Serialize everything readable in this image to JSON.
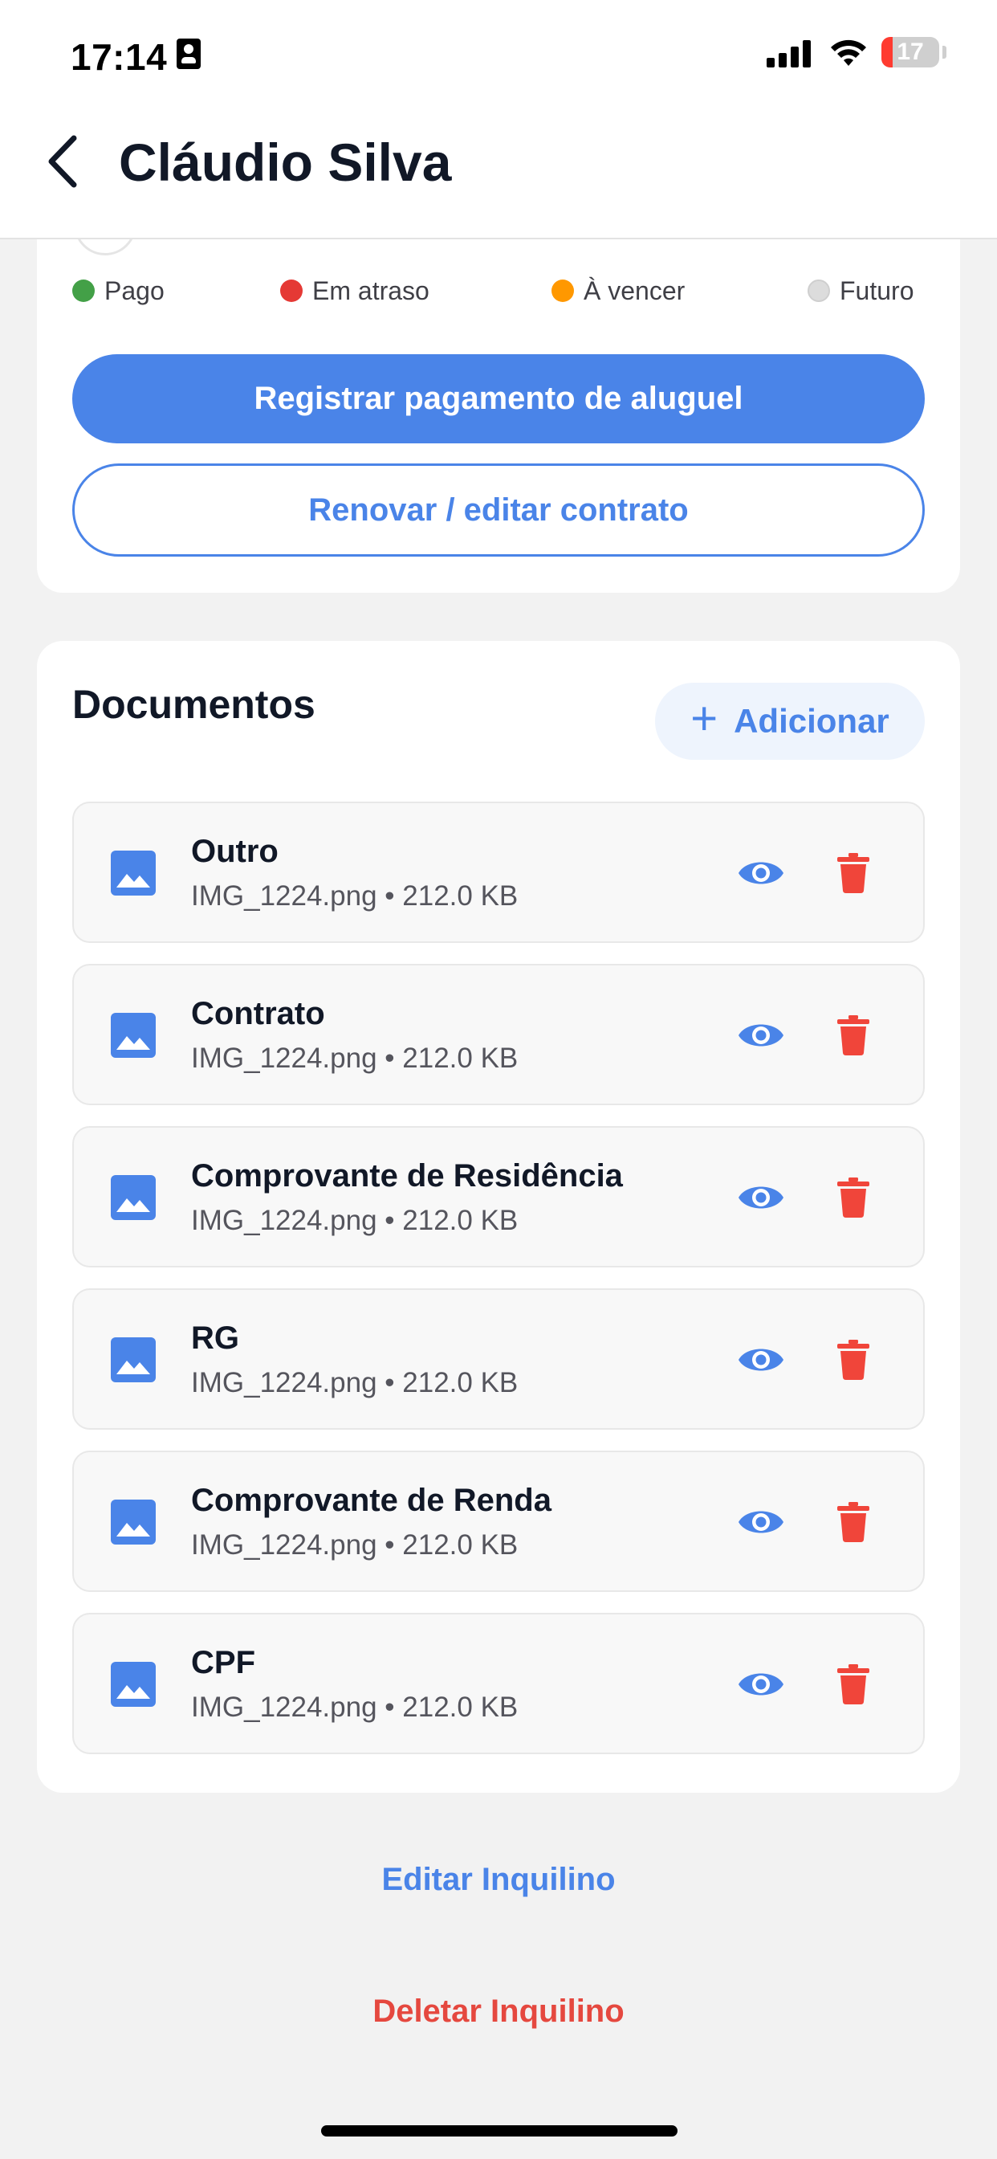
{
  "status_bar": {
    "time": "17:14",
    "battery": "17"
  },
  "header": {
    "title": "Cláudio Silva"
  },
  "legend": [
    {
      "label": "Pago",
      "color": "#43a047"
    },
    {
      "label": "Em atraso",
      "color": "#e53935"
    },
    {
      "label": "À vencer",
      "color": "#ff9800"
    },
    {
      "label": "Futuro",
      "color": "#dcdcdc"
    }
  ],
  "actions": {
    "register_payment": "Registrar pagamento de aluguel",
    "renew_contract": "Renovar / editar contrato"
  },
  "documents": {
    "title": "Documentos",
    "add_label": "Adicionar",
    "items": [
      {
        "name": "Outro",
        "file": "IMG_1224.png",
        "size": "212.0 KB"
      },
      {
        "name": "Contrato",
        "file": "IMG_1224.png",
        "size": "212.0 KB"
      },
      {
        "name": "Comprovante de Residência",
        "file": "IMG_1224.png",
        "size": "212.0 KB"
      },
      {
        "name": "RG",
        "file": "IMG_1224.png",
        "size": "212.0 KB"
      },
      {
        "name": "Comprovante de Renda",
        "file": "IMG_1224.png",
        "size": "212.0 KB"
      },
      {
        "name": "CPF",
        "file": "IMG_1224.png",
        "size": "212.0 KB"
      }
    ]
  },
  "footer": {
    "edit_label": "Editar Inquilino",
    "delete_label": "Deletar Inquilino"
  },
  "colors": {
    "primary": "#4a84e8",
    "danger": "#e5483f",
    "trash": "#f0453a"
  },
  "icons": {
    "back": "chevron-left-icon",
    "doc": "image-icon",
    "view": "eye-icon",
    "delete": "trash-icon",
    "add": "plus-icon"
  }
}
